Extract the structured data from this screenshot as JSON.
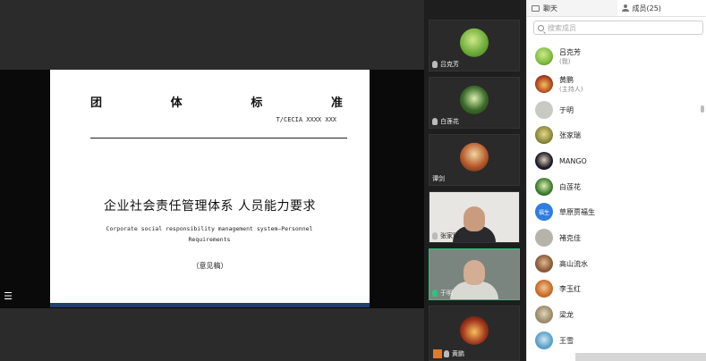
{
  "slide": {
    "header_chars": [
      "团",
      "体",
      "标",
      "准"
    ],
    "code": "T/CECIA XXXX XXX",
    "title": "企业社会责任管理体系  人员能力要求",
    "subtitle_en_line1": "Corporate social responsibility management system—Personnel",
    "subtitle_en_line2": "Requirements",
    "draft": "（意见稿）"
  },
  "videos": [
    {
      "name": "吕克芳",
      "mic": "muted",
      "kind": "avatar",
      "color": "#6fae3a"
    },
    {
      "name": "白莲花",
      "mic": "muted",
      "kind": "avatar",
      "color": "#3c6a2b"
    },
    {
      "name": "谭剑",
      "mic": "none",
      "kind": "avatar",
      "color": "#b85a2c"
    },
    {
      "name": "张家瑞",
      "mic": "muted",
      "kind": "camera",
      "color": "#e8e6e2"
    },
    {
      "name": "于明",
      "mic": "on",
      "kind": "camera",
      "color": "#6e7a75"
    },
    {
      "name": "黄鹏",
      "mic": "muted",
      "kind": "avatar",
      "color": "#a2361c",
      "host": true
    }
  ],
  "panel": {
    "tab_chat": "聊天",
    "tab_members": "成员(25)",
    "search_placeholder": "搜索成员",
    "members": [
      {
        "name": "吕克芳",
        "sub": "(我)",
        "color": "#7dbb3f"
      },
      {
        "name": "黄鹏",
        "sub": "(主持人)",
        "color": "#b0421f"
      },
      {
        "name": "于明",
        "sub": "",
        "color": "#c9c9c4"
      },
      {
        "name": "张家瑞",
        "sub": "",
        "color": "#8c8a3a"
      },
      {
        "name": "MANGO",
        "sub": "",
        "color": "#1b1b2a"
      },
      {
        "name": "白莲花",
        "sub": "",
        "color": "#3f7b2f"
      },
      {
        "name": "草原贾福生",
        "sub": "",
        "color": "#2f7de0",
        "initials": "福生"
      },
      {
        "name": "褚克佳",
        "sub": "",
        "color": "#b6b4aa"
      },
      {
        "name": "高山流水",
        "sub": "",
        "color": "#8a5a3a"
      },
      {
        "name": "李玉红",
        "sub": "",
        "color": "#c76a2a"
      },
      {
        "name": "梁龙",
        "sub": "",
        "color": "#9a8a6a"
      },
      {
        "name": "王雪",
        "sub": "",
        "color": "#5aa0c8"
      }
    ]
  }
}
